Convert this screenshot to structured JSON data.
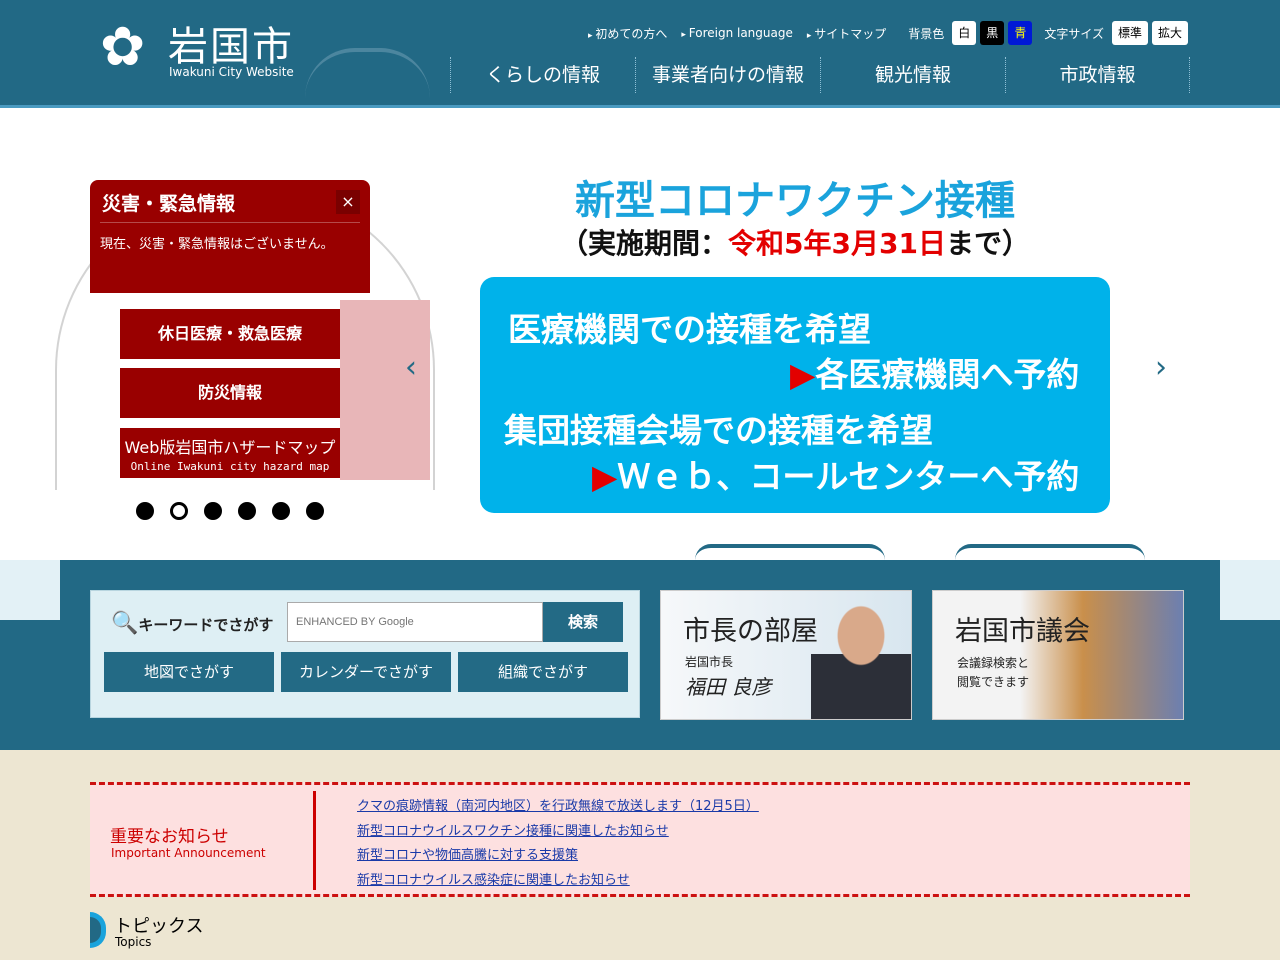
{
  "header": {
    "logo_name": "岩国市",
    "logo_sub": "Iwakuni City Website",
    "util_links": [
      "初めての方へ",
      "Foreign language",
      "サイトマップ"
    ],
    "bg_label": "背景色",
    "bg_options": [
      "白",
      "黒",
      "青"
    ],
    "size_label": "文字サイズ",
    "size_options": [
      "標準",
      "拡大"
    ],
    "nav": [
      "くらしの情報",
      "事業者向けの情報",
      "観光情報",
      "市政情報"
    ]
  },
  "emergency": {
    "title": "災害・緊急情報",
    "close": "×",
    "message": "現在、災害・緊急情報はございません。",
    "buttons": [
      "休日医療・救急医療",
      "防災情報"
    ],
    "hazard": "Web版岩国市ハザードマップ",
    "hazard_en": "Online Iwakuni city hazard map"
  },
  "slider": {
    "dots": 6,
    "active": 2,
    "prev": "‹",
    "next": "›"
  },
  "banner": {
    "title": "新型コロナワクチン接種",
    "sub_pre": "（実施期間：",
    "sub_red": "令和5年3月31日",
    "sub_post": "まで）",
    "line1": "医療機関での接種を希望",
    "line2": "各医療機関へ予約",
    "line3": "集団接種会場での接種を希望",
    "line4": "Ｗｅｂ、コールセンターへ予約",
    "arrow": "▶"
  },
  "search": {
    "label": "キーワードでさがす",
    "placeholder": "ENHANCED BY Google",
    "submit": "検索",
    "buttons": [
      "地図でさがす",
      "カレンダーでさがす",
      "組織でさがす"
    ]
  },
  "mayor": {
    "title": "市長の部屋",
    "role": "岩国市長",
    "name": "福田 良彦"
  },
  "assembly": {
    "title": "岩国市議会",
    "desc1": "会議録検索と",
    "desc2": "閲覧できます"
  },
  "announcement": {
    "title": "重要なお知らせ",
    "title_en": "Important Announcement",
    "items": [
      "クマの痕跡情報（南河内地区）を行政無線で放送します（12月5日）",
      "新型コロナウイルスワクチン接種に関連したお知らせ",
      "新型コロナや物価高騰に対する支援策",
      "新型コロナウイルス感染症に関連したお知らせ"
    ]
  },
  "topics": {
    "title": "トピックス",
    "title_en": "Topics"
  },
  "colors": {
    "header": "#226985",
    "emergency": "#990000",
    "banner": "#00b2ea",
    "title": "#1aa3dc"
  }
}
